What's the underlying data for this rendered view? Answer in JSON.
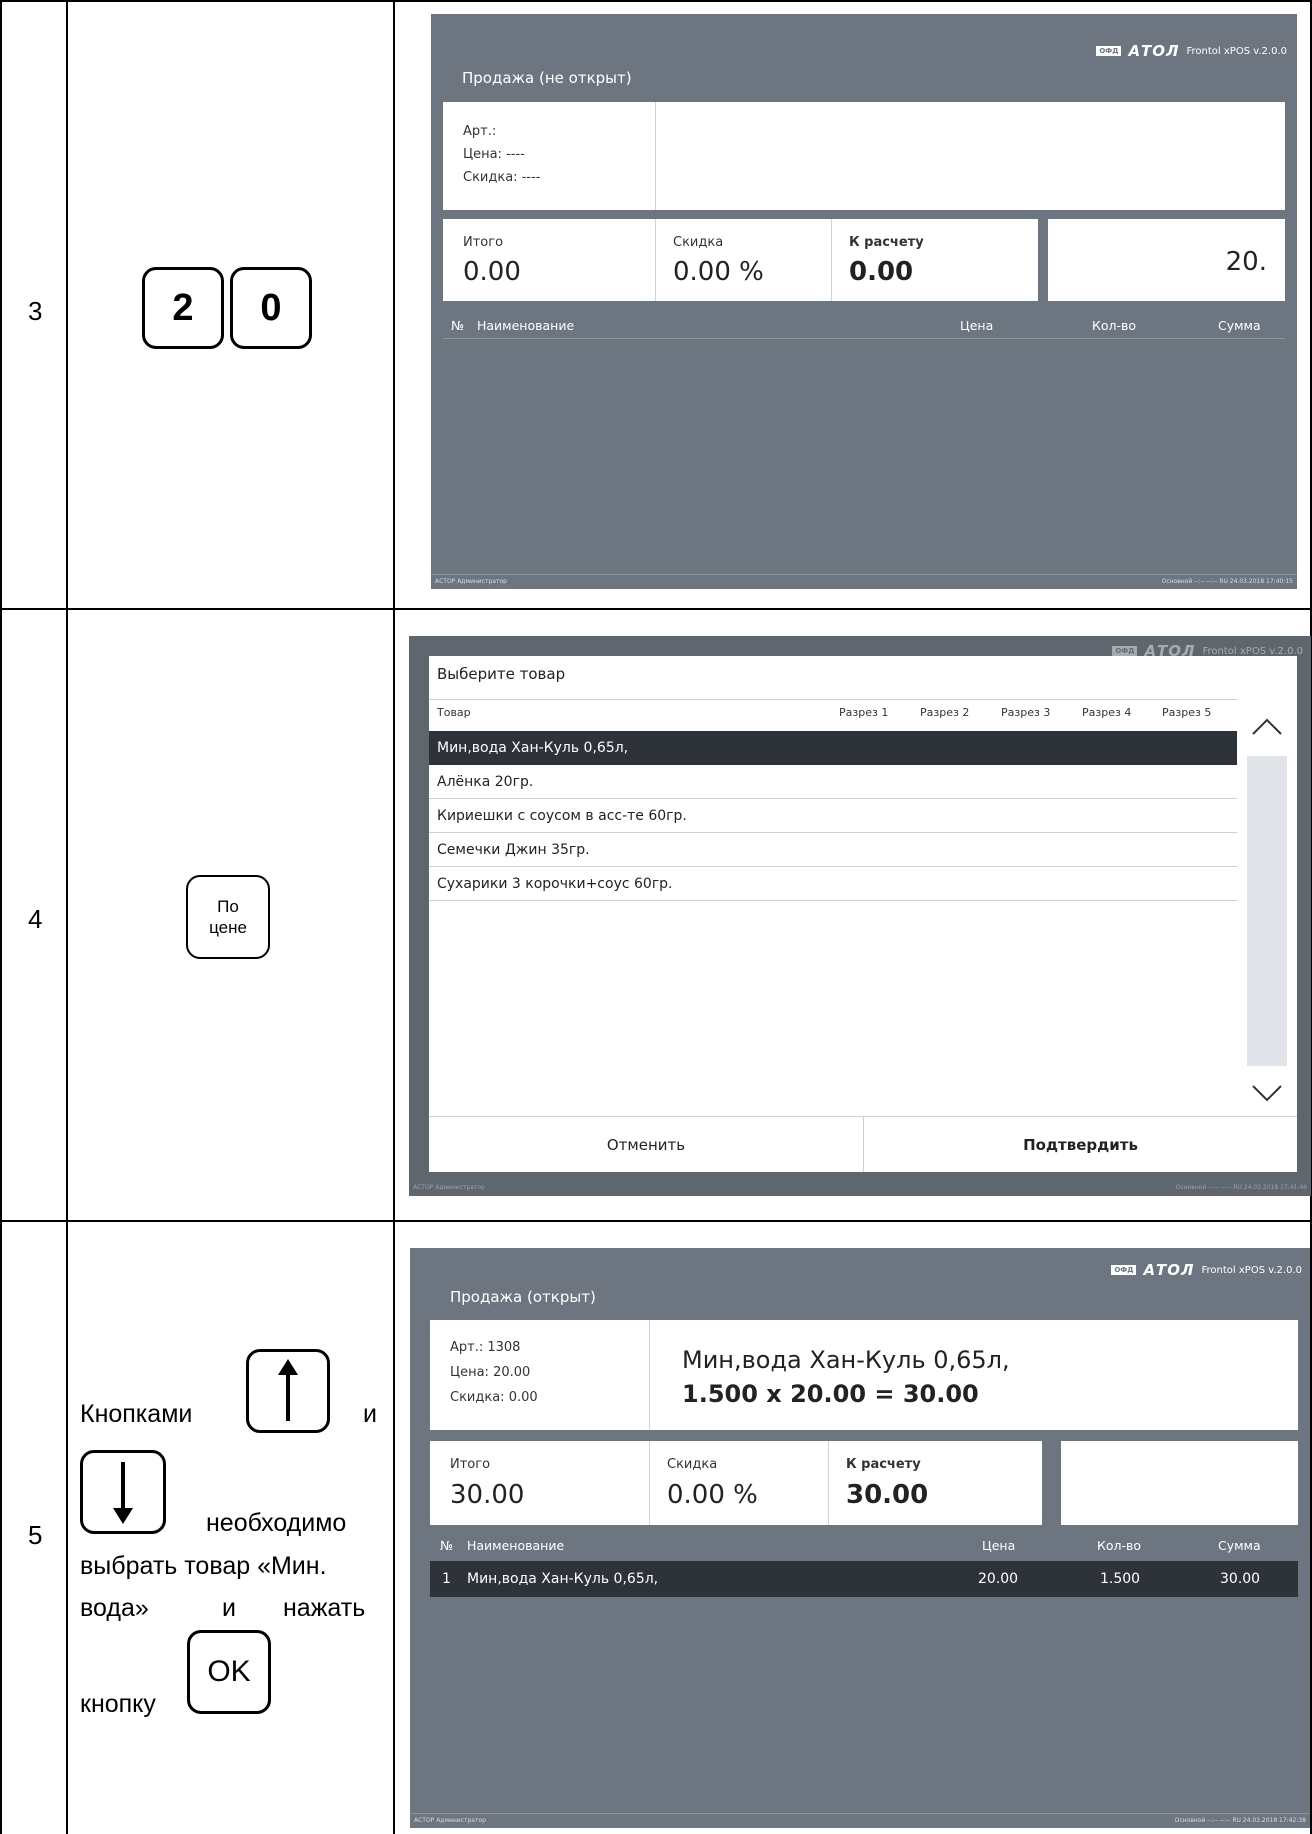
{
  "steps": [
    {
      "number": "3",
      "keys": [
        "2",
        "0"
      ],
      "screen": {
        "title": "Продажа (не открыт)",
        "logo": {
          "ofd": "ОФД",
          "brand": "АТОЛ",
          "version": "Frontol xPOS v.2.0.0"
        },
        "info": {
          "art": "Арт.:",
          "price": "Цена:  ----",
          "discount": "Скидка:   ----"
        },
        "totals": {
          "total_label": "Итого",
          "total_value": "0.00",
          "discount_label": "Скидка",
          "discount_value": "0.00 %",
          "pay_label": "К расчету",
          "pay_value": "0.00"
        },
        "input_value": "20.",
        "columns": [
          "№",
          "Наименование",
          "Цена",
          "Кол-во",
          "Сумма"
        ],
        "status_left": "АСТОР  Администратор",
        "status_right": "Основной    --:--    --:--    RU       24.03.2018 17:40:15"
      }
    },
    {
      "number": "4",
      "key_line1": "По",
      "key_line2": "цене",
      "screen": {
        "logo": {
          "ofd": "ОФД",
          "brand": "АТОЛ",
          "version": "Frontol xPOS v.2.0.0"
        },
        "dialog_title": "Выберите товар",
        "columns": [
          "Товар",
          "Разрез 1",
          "Разрез 2",
          "Разрез 3",
          "Разрез 4",
          "Разрез 5"
        ],
        "items": [
          "Мин,вода Хан-Куль 0,65л,",
          "Алёнка 20гр.",
          "Кириешки с соусом в асс-те 60гр.",
          "Семечки Джин 35гр.",
          "Сухарики 3 корочки+соус 60гр."
        ],
        "cancel": "Отменить",
        "confirm": "Подтвердить",
        "status_left": "АСТОР  Администратор",
        "status_right": "Основной    --:--    --:--    RU       24.03.2018 17:41:46"
      }
    },
    {
      "number": "5",
      "instr": {
        "w1": "Кнопками",
        "w2": "и",
        "w3": "необходимо",
        "line3": "выбрать товар «Мин.",
        "line4a": "вода»",
        "line4b": "и",
        "line4c": "нажать",
        "line5": "кнопку"
      },
      "ok_key": "OK",
      "screen": {
        "title": "Продажа (открыт)",
        "logo": {
          "ofd": "ОФД",
          "brand": "АТОЛ",
          "version": "Frontol xPOS v.2.0.0"
        },
        "info": {
          "art": "Арт.:  1308",
          "price": "Цена:   20.00",
          "discount": "Скидка:    0.00"
        },
        "product_name": "Мин,вода Хан-Куль 0,65л,",
        "product_calc": "1.500 x 20.00 = 30.00",
        "totals": {
          "total_label": "Итого",
          "total_value": "30.00",
          "discount_label": "Скидка",
          "discount_value": "0.00 %",
          "pay_label": "К расчету",
          "pay_value": "30.00"
        },
        "columns": [
          "№",
          "Наименование",
          "Цена",
          "Кол-во",
          "Сумма"
        ],
        "line": {
          "num": "1",
          "name": "Мин,вода Хан-Куль 0,65л,",
          "price": "20.00",
          "qty": "1.500",
          "sum": "30.00"
        },
        "status_left": "АСТОР  Администратор",
        "status_right": "Основной    --:--    --:--    RU       24.03.2018 17:42:38"
      }
    }
  ]
}
